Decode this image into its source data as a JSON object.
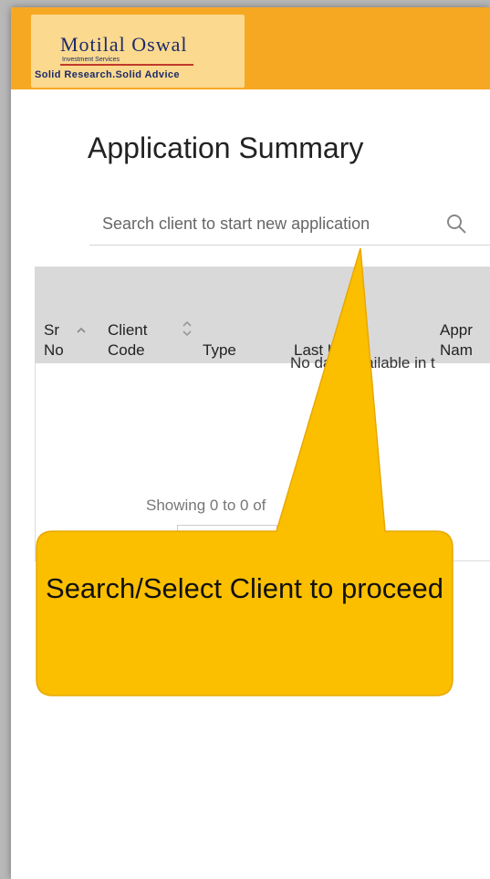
{
  "logo": {
    "brand": "Motilal Oswal",
    "subtitle": "Investment Services",
    "tagline": "Solid Research.Solid Advice"
  },
  "page": {
    "title": "Application Summary"
  },
  "search": {
    "placeholder": "Search client to start new application",
    "icon": "search-icon"
  },
  "table": {
    "columns": [
      {
        "line1": "Sr",
        "line2": "No",
        "sort": "ascending"
      },
      {
        "line1": "Client",
        "line2": "Code",
        "sort": "both"
      },
      {
        "line1": "",
        "line2": "Type"
      },
      {
        "line1": "",
        "line2": "Last Used"
      },
      {
        "line1": "Appr",
        "line2": "Nam"
      }
    ],
    "empty_text": "No data available in t",
    "info_text": "Showing 0 to 0 of"
  },
  "callout": {
    "text": "Search/Select Client to proceed",
    "color": "#fbbf00"
  },
  "colors": {
    "header": "#f7a823",
    "table_header": "#d9d9d9"
  }
}
